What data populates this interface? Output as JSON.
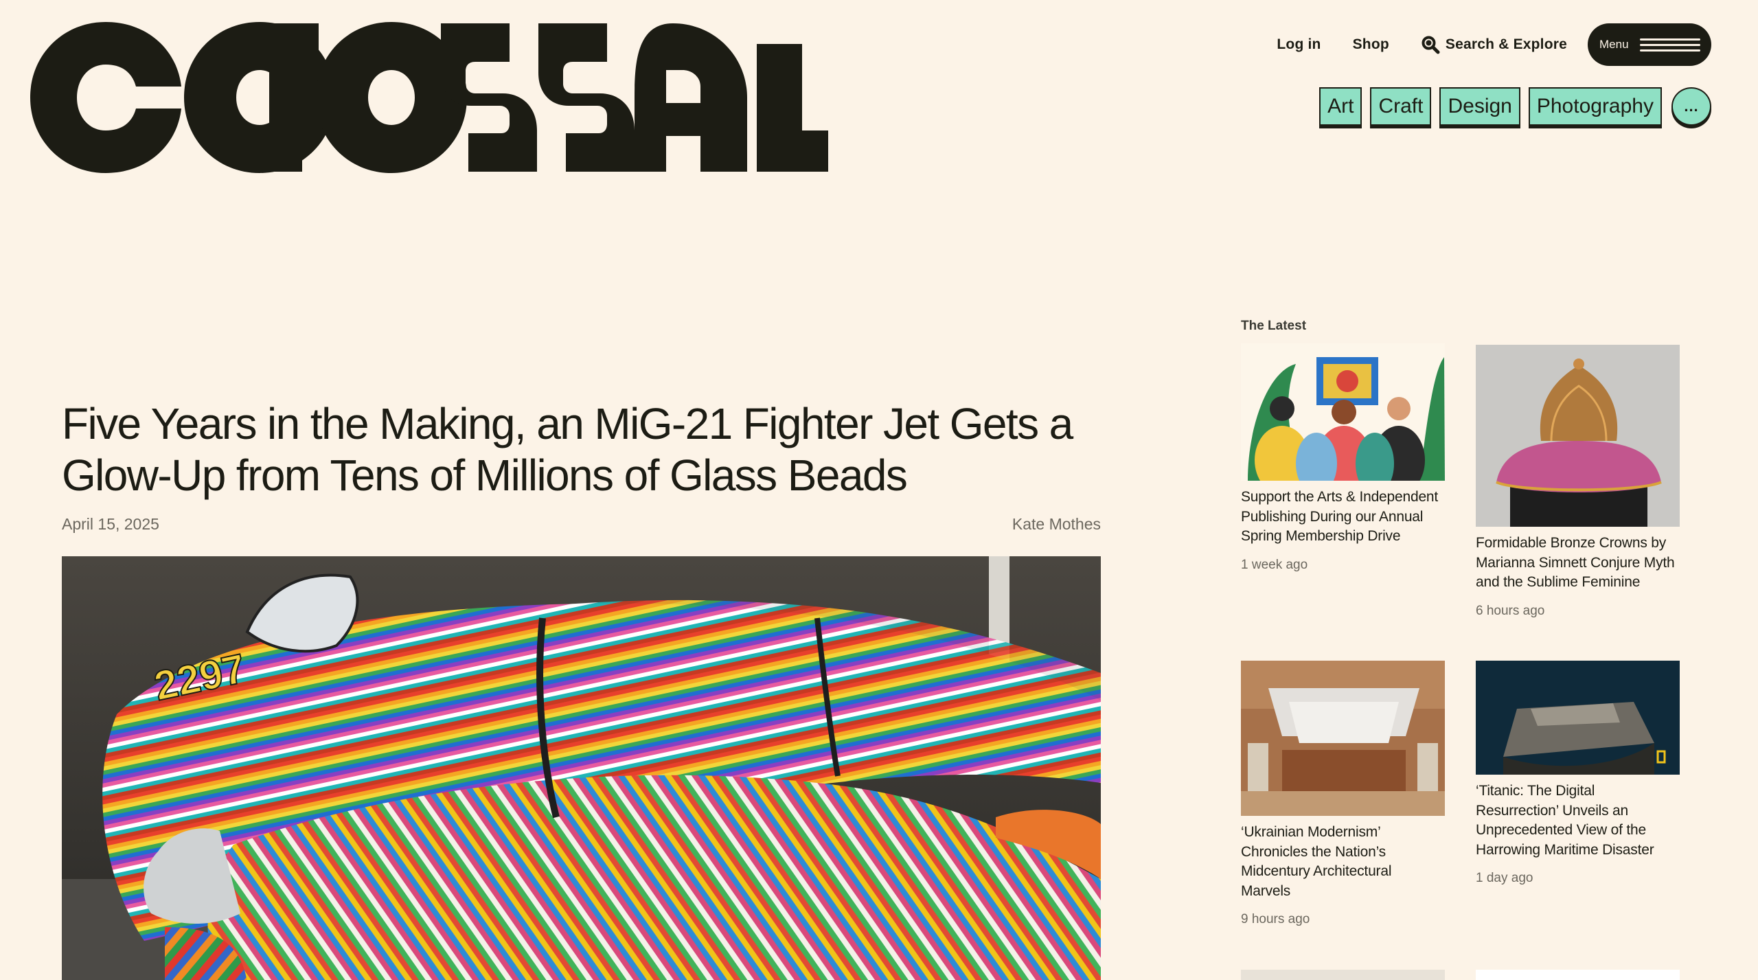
{
  "brand": {
    "name": "COLOSSAL"
  },
  "util_nav": {
    "login": "Log in",
    "shop": "Shop",
    "search": "Search & Explore",
    "menu": "Menu"
  },
  "categories": [
    "Art",
    "Craft",
    "Design",
    "Photography"
  ],
  "more_label": "...",
  "article": {
    "headline": "Five Years in the Making, an MiG-21 Fighter Jet Gets a Glow-Up from Tens of Millions of Glass Beads",
    "date": "April 15, 2025",
    "author": "Kate Mothes"
  },
  "latest": {
    "heading": "The Latest",
    "items": [
      {
        "title": "Support the Arts & Independent Publishing During our Annual Spring Membership Drive",
        "time": "1 week ago"
      },
      {
        "title": "Formidable Bronze Crowns by Marianna Simnett Conjure Myth and the Sublime Feminine",
        "time": "6 hours ago"
      },
      {
        "title": "‘Ukrainian Modernism’ Chronicles the Nation’s Midcentury Architectural Marvels",
        "time": "9 hours ago"
      },
      {
        "title": "‘Titanic: The Digital Resurrection’ Unveils an Unprecedented View of the Harrowing Maritime Disaster",
        "time": "1 day ago"
      }
    ]
  },
  "colors": {
    "background": "#fcf3e7",
    "ink": "#1c1c14",
    "category_accent": "#8fe0c4",
    "muted_text": "#6b675e"
  },
  "icons": [
    "search-icon",
    "hamburger-icon"
  ]
}
